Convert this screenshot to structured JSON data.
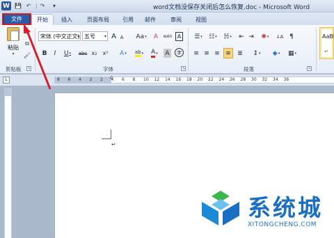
{
  "window": {
    "title": "word文档没保存关闭后怎么恢复.doc - Microsoft Word",
    "app_icon": "W"
  },
  "quick_access": {
    "save_icon": "💾",
    "undo_icon": "↶",
    "redo_icon": "↷",
    "separator": "|",
    "customize_icon": "▾"
  },
  "tabs": {
    "file": "文件",
    "home": "开始",
    "insert": "插入",
    "layout": "页面布局",
    "references": "引用",
    "mailings": "邮件",
    "review": "审阅",
    "view": "视图"
  },
  "ribbon": {
    "clipboard": {
      "label": "剪贴板",
      "paste": "粘贴",
      "paste_arrow": "▾",
      "cut_icon": "✂",
      "copy_icon": "⧉",
      "format_painter_icon": "🖌"
    },
    "font": {
      "label": "字体",
      "name": "宋体 (中文正文)",
      "size": "五号",
      "grow": "A",
      "shrink": "A",
      "change_case": "Aa",
      "clear_format": "A",
      "phonetic": "wén",
      "char_border": "A",
      "bold": "B",
      "italic": "I",
      "underline": "U",
      "strike": "abc",
      "subscript": "x₂",
      "superscript": "x²",
      "text_effect": "A",
      "highlight": "ab",
      "font_color": "A",
      "char_shading": "A",
      "enclose": "字"
    },
    "paragraph": {
      "label": "段落",
      "bullets": "☰",
      "numbering": "☷",
      "multilevel": "☵",
      "decrease_indent": "⇤",
      "increase_indent": "⇥",
      "chinese_layout": "✱",
      "sort": "↓A",
      "show_marks": "¶",
      "align_left": "≡",
      "align_center": "≡",
      "align_right": "≡",
      "justify": "≡",
      "distribute": "≣",
      "line_spacing": "↕",
      "shading": "◆",
      "borders": "▦"
    },
    "styles": {
      "sample": "AaBb",
      "mark": "↵"
    },
    "dropdown_glyph": "▾",
    "launcher_glyph": "↘"
  },
  "ruler": {
    "corner": "L",
    "numbers": [
      "8",
      "6",
      "4",
      "2",
      "2",
      "4",
      "6",
      "8",
      "10",
      "12",
      "14",
      "16",
      "18",
      "20",
      "22",
      "24",
      "26",
      "28",
      "30",
      "32",
      "34",
      "36"
    ],
    "indent_glyph": "⌂"
  },
  "document": {
    "paragraph_mark": "↵"
  },
  "watermark": {
    "site_name": "系统城",
    "url": "XITONGCHENG.COM"
  },
  "colors": {
    "highlight_frame": "#d41e2a",
    "file_tab": "#2b5ca8",
    "watermark_blue": "#1b6fc2",
    "watermark_green": "#3cb54a"
  }
}
